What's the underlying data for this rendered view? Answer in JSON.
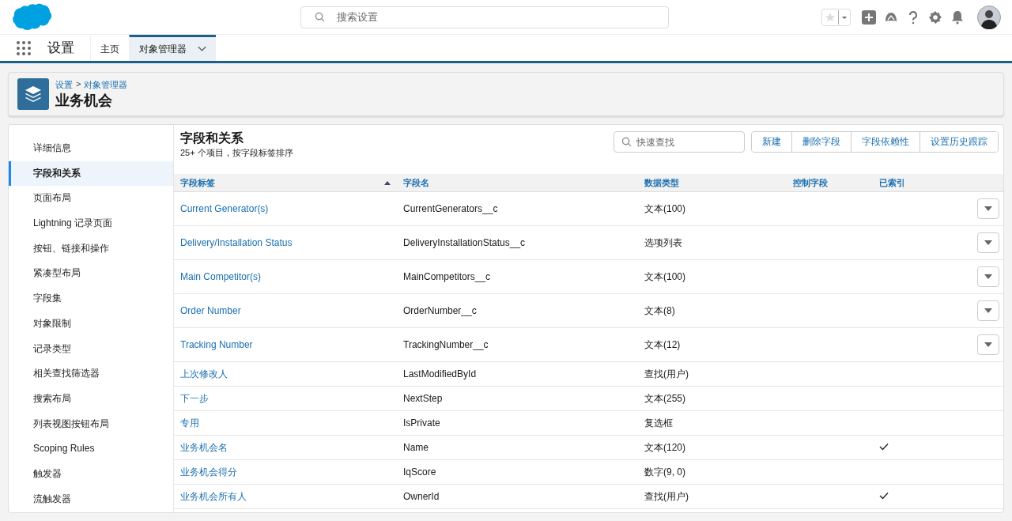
{
  "header": {
    "search_placeholder": "搜索设置"
  },
  "nav": {
    "app_name": "设置",
    "tabs": [
      {
        "label": "主页",
        "selected": false,
        "has_menu": false
      },
      {
        "label": "对象管理器",
        "selected": true,
        "has_menu": true
      }
    ]
  },
  "page_header": {
    "breadcrumb": [
      {
        "label": "设置"
      },
      {
        "label": "对象管理器"
      }
    ],
    "breadcrumb_separator": ">",
    "title": "业务机会"
  },
  "sidebar": {
    "items": [
      {
        "label": "详细信息",
        "selected": false
      },
      {
        "label": "字段和关系",
        "selected": true
      },
      {
        "label": "页面布局",
        "selected": false
      },
      {
        "label": "Lightning 记录页面",
        "selected": false
      },
      {
        "label": "按钮、链接和操作",
        "selected": false
      },
      {
        "label": "紧凑型布局",
        "selected": false
      },
      {
        "label": "字段集",
        "selected": false
      },
      {
        "label": "对象限制",
        "selected": false
      },
      {
        "label": "记录类型",
        "selected": false
      },
      {
        "label": "相关查找筛选器",
        "selected": false
      },
      {
        "label": "搜索布局",
        "selected": false
      },
      {
        "label": "列表视图按钮布局",
        "selected": false
      },
      {
        "label": "Scoping Rules",
        "selected": false
      },
      {
        "label": "触发器",
        "selected": false
      },
      {
        "label": "流触发器",
        "selected": false
      }
    ]
  },
  "section": {
    "title": "字段和关系",
    "subtitle": "25+ 个项目，按字段标签排序",
    "quick_find_placeholder": "快速查找",
    "buttons": [
      "新建",
      "删除字段",
      "字段依赖性",
      "设置历史跟踪"
    ]
  },
  "table": {
    "columns": [
      {
        "label": "字段标签",
        "sorted": true
      },
      {
        "label": "字段名",
        "sorted": false
      },
      {
        "label": "数据类型",
        "sorted": false
      },
      {
        "label": "控制字段",
        "sorted": false
      },
      {
        "label": "已索引",
        "sorted": false
      }
    ],
    "rows": [
      {
        "label": "Current Generator(s)",
        "name": "CurrentGenerators__c",
        "type": "文本(100)",
        "indexed": false,
        "has_menu": true
      },
      {
        "label": "Delivery/Installation Status",
        "name": "DeliveryInstallationStatus__c",
        "type": "选项列表",
        "indexed": false,
        "has_menu": true
      },
      {
        "label": "Main Competitor(s)",
        "name": "MainCompetitors__c",
        "type": "文本(100)",
        "indexed": false,
        "has_menu": true
      },
      {
        "label": "Order Number",
        "name": "OrderNumber__c",
        "type": "文本(8)",
        "indexed": false,
        "has_menu": true
      },
      {
        "label": "Tracking Number",
        "name": "TrackingNumber__c",
        "type": "文本(12)",
        "indexed": false,
        "has_menu": true
      },
      {
        "label": "上次修改人",
        "name": "LastModifiedById",
        "type": "查找(用户)",
        "indexed": false,
        "has_menu": false
      },
      {
        "label": "下一步",
        "name": "NextStep",
        "type": "文本(255)",
        "indexed": false,
        "has_menu": false
      },
      {
        "label": "专用",
        "name": "IsPrivate",
        "type": "复选框",
        "indexed": false,
        "has_menu": false
      },
      {
        "label": "业务机会名",
        "name": "Name",
        "type": "文本(120)",
        "indexed": true,
        "has_menu": false
      },
      {
        "label": "业务机会得分",
        "name": "IqScore",
        "type": "数字(9, 0)",
        "indexed": false,
        "has_menu": false
      },
      {
        "label": "业务机会所有人",
        "name": "OwnerId",
        "type": "查找(用户)",
        "indexed": true,
        "has_menu": false
      }
    ]
  }
}
